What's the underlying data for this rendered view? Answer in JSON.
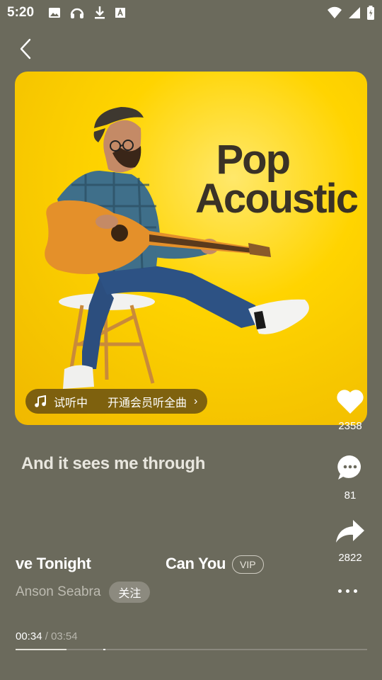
{
  "status_bar": {
    "time": "5:20"
  },
  "cover": {
    "title_line1": "Pop",
    "title_line2": "Acoustic",
    "preview_label": "试听中",
    "vip_prompt": "开通会员听全曲",
    "preview_arrow": "›"
  },
  "actions": {
    "like_count": "2358",
    "comment_count": "81",
    "share_count": "2822"
  },
  "lyric": {
    "current": "And it sees me through"
  },
  "song": {
    "title_part1": "ve Tonight",
    "title_part2": "Can You",
    "badge": "VIP",
    "artist": "Anson Seabra",
    "follow_label": "关注"
  },
  "playback": {
    "current_time": "00:34",
    "separator": "/",
    "total_time": "03:54",
    "progress_fraction": 0.145
  },
  "colors": {
    "background": "#6b6a5c",
    "cover_yellow": "#ffd400",
    "cover_text": "#3a3226"
  }
}
